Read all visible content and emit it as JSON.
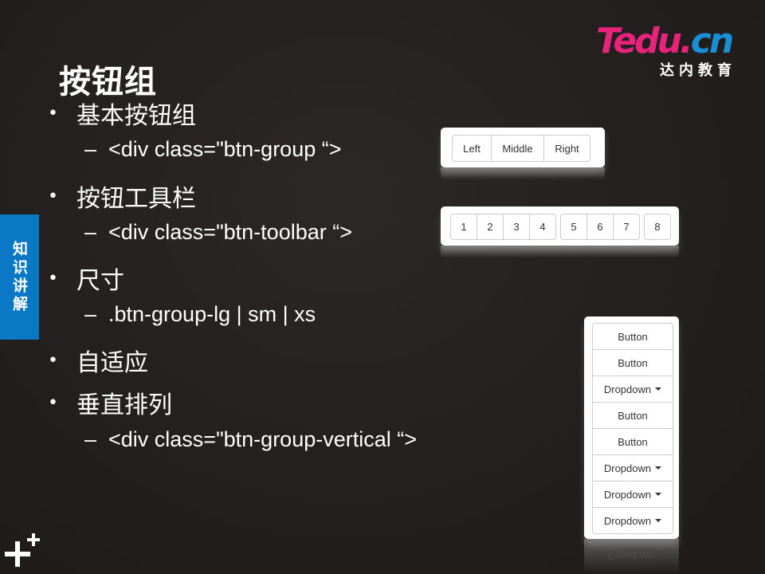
{
  "logo": {
    "brand_t": "T",
    "brand_rest": "edu.",
    "brand_cn": "cn",
    "subtitle": "达内教育"
  },
  "slide": {
    "title": "按钮组",
    "side_tab": "知识讲解"
  },
  "bullets": [
    {
      "dot": "•",
      "text": "基本按钮组"
    },
    {
      "dot": "•",
      "text": "按钮工具栏"
    },
    {
      "dot": "•",
      "text": "尺寸"
    },
    {
      "dot": "•",
      "text": "自适应"
    },
    {
      "dot": "•",
      "text": "垂直排列"
    }
  ],
  "subs": [
    {
      "dash": "–",
      "text": "<div class=\"btn-group “>"
    },
    {
      "dash": "–",
      "text": "<div class=\"btn-toolbar “>"
    },
    {
      "dash": "–",
      "text": ".btn-group-lg | sm | xs"
    },
    {
      "dash": "–",
      "text": "<div class=\"btn-group-vertical “>"
    }
  ],
  "basic_group": [
    "Left",
    "Middle",
    "Right"
  ],
  "toolbar": {
    "group1": [
      "1",
      "2",
      "3",
      "4"
    ],
    "group2": [
      "5",
      "6",
      "7"
    ],
    "group3": [
      "8"
    ]
  },
  "vertical": [
    "Button",
    "Button",
    "Dropdown",
    "Button",
    "Button",
    "Dropdown",
    "Dropdown",
    "Dropdown"
  ],
  "vertical_reflection": "Dropdown",
  "colors": {
    "background": "#231f1f",
    "accent_blue": "#0a78c4",
    "brand_pink": "#e8237c",
    "brand_blue": "#1a8fd6"
  }
}
